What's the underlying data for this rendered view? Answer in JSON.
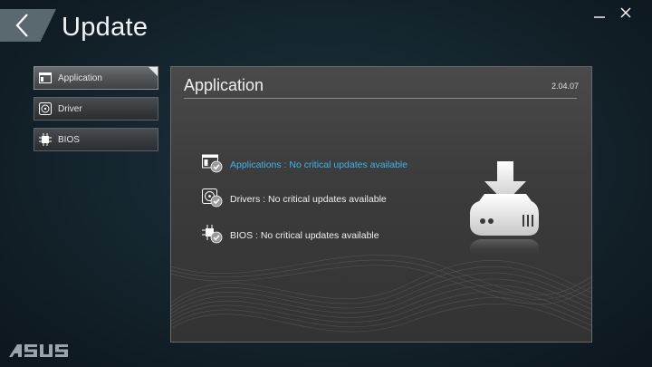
{
  "window": {
    "title": "Update",
    "back_icon": "chevron-left-icon",
    "min_icon": "minimize-icon",
    "close_icon": "close-icon"
  },
  "sidebar": {
    "items": [
      {
        "label": "Application",
        "icon": "application-window-icon",
        "active": true
      },
      {
        "label": "Driver",
        "icon": "disc-icon",
        "active": false
      },
      {
        "label": "BIOS",
        "icon": "chip-icon",
        "active": false
      }
    ]
  },
  "panel": {
    "title": "Application",
    "version": "2.04.07",
    "statuses": [
      {
        "text": "Applications : No critical updates available",
        "icon": "application-check-icon",
        "highlighted": true
      },
      {
        "text": "Drivers : No critical updates available",
        "icon": "disc-check-icon",
        "highlighted": false
      },
      {
        "text": "BIOS : No critical updates available",
        "icon": "chip-check-icon",
        "highlighted": false
      }
    ],
    "illustration_icon": "download-to-drive-icon"
  },
  "brand": {
    "logo_text": "ASUS"
  },
  "colors": {
    "highlight": "#3fb4ee",
    "panel": "#3c3c3c",
    "background": "#14232c"
  }
}
